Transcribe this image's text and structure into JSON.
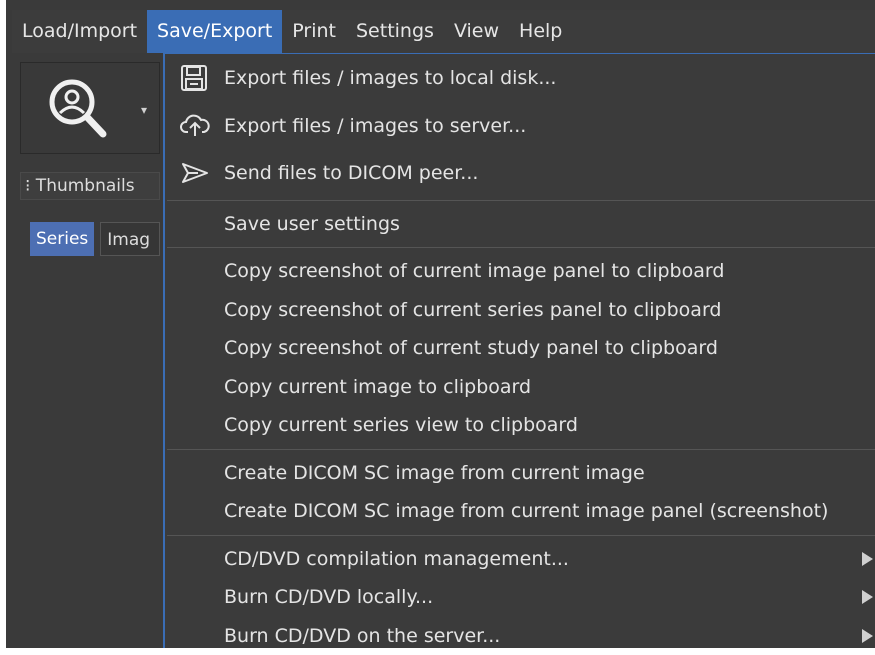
{
  "menubar": {
    "items": [
      {
        "label": "Load/Import",
        "active": false
      },
      {
        "label": "Save/Export",
        "active": true
      },
      {
        "label": "Print",
        "active": false
      },
      {
        "label": "Settings",
        "active": false
      },
      {
        "label": "View",
        "active": false
      },
      {
        "label": "Help",
        "active": false
      }
    ]
  },
  "toolbar": {
    "search_button_icon": "magnifier-icon",
    "dropdown_caret": "▾"
  },
  "sidepanel": {
    "thumbnails_label": "⁝ Thumbnails",
    "tabs": [
      "Series",
      "Imag"
    ]
  },
  "dropdown": {
    "groups": [
      [
        {
          "label": "Export files / images to local disk...",
          "icon": "floppy-disk-icon"
        },
        {
          "label": "Export files / images to server...",
          "icon": "cloud-upload-icon"
        },
        {
          "label": "Send files to DICOM peer...",
          "icon": "send-icon"
        }
      ],
      [
        {
          "label": "Save user settings"
        }
      ],
      [
        {
          "label": "Copy screenshot of current image panel to clipboard"
        },
        {
          "label": "Copy screenshot of current series panel to clipboard"
        },
        {
          "label": "Copy screenshot of current study panel to clipboard"
        },
        {
          "label": "Copy current image to clipboard"
        },
        {
          "label": "Copy current series view to clipboard"
        }
      ],
      [
        {
          "label": "Create DICOM SC image from current image"
        },
        {
          "label": "Create DICOM SC image from current image panel (screenshot)"
        }
      ],
      [
        {
          "label": "CD/DVD compilation management...",
          "submenu": true
        },
        {
          "label": "Burn CD/DVD locally...",
          "submenu": true
        },
        {
          "label": "Burn CD/DVD on the server...",
          "submenu": true
        }
      ]
    ]
  },
  "colors": {
    "accent": "#3a6db5",
    "background": "#3a3a3a",
    "menu_text": "#e4e4e4"
  }
}
